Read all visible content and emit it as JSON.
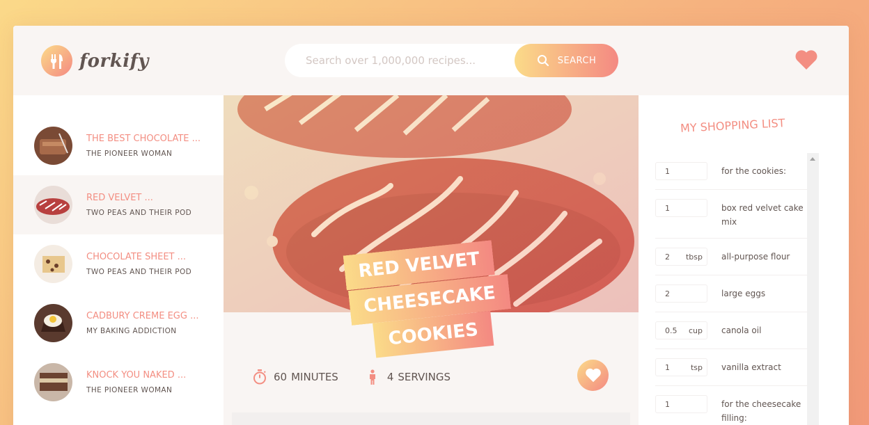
{
  "app": {
    "name": "forkify"
  },
  "search": {
    "placeholder": "Search over 1,000,000 recipes...",
    "button_label": "SEARCH"
  },
  "results": [
    {
      "title": "THE BEST CHOCOLATE ...",
      "author": "THE PIONEER WOMAN",
      "active": false
    },
    {
      "title": "RED VELVET ...",
      "author": "TWO PEAS AND THEIR POD",
      "active": true
    },
    {
      "title": "CHOCOLATE SHEET ...",
      "author": "TWO PEAS AND THEIR POD",
      "active": false
    },
    {
      "title": "CADBURY CREME EGG ...",
      "author": "MY BAKING ADDICTION",
      "active": false
    },
    {
      "title": "KNOCK YOU NAKED ...",
      "author": "THE PIONEER WOMAN",
      "active": false
    }
  ],
  "recipe": {
    "title_line1": "RED VELVET CHEESECAKE",
    "title_line2": "COOKIES",
    "minutes": "60",
    "minutes_label": "MINUTES",
    "servings": "4",
    "servings_label": "SERVINGS"
  },
  "shopping": {
    "title": "MY SHOPPING LIST",
    "items": [
      {
        "count": "1",
        "unit": "",
        "desc": "for the cookies:"
      },
      {
        "count": "1",
        "unit": "",
        "desc": "box red velvet cake mix"
      },
      {
        "count": "2",
        "unit": "tbsp",
        "desc": "all-purpose flour"
      },
      {
        "count": "2",
        "unit": "",
        "desc": "large eggs"
      },
      {
        "count": "0.5",
        "unit": "cup",
        "desc": "canola oil"
      },
      {
        "count": "1",
        "unit": "tsp",
        "desc": "vanilla extract"
      },
      {
        "count": "1",
        "unit": "",
        "desc": "for the cheesecake filling:"
      }
    ]
  },
  "colors": {
    "accent_start": "#fbdb89",
    "accent_end": "#f48982",
    "text": "#615551",
    "link": "#f38e82"
  },
  "icons": {
    "logo": "fork-knife-icon",
    "search": "search-icon",
    "likes": "heart-icon",
    "time": "stopwatch-icon",
    "servings": "person-icon"
  }
}
